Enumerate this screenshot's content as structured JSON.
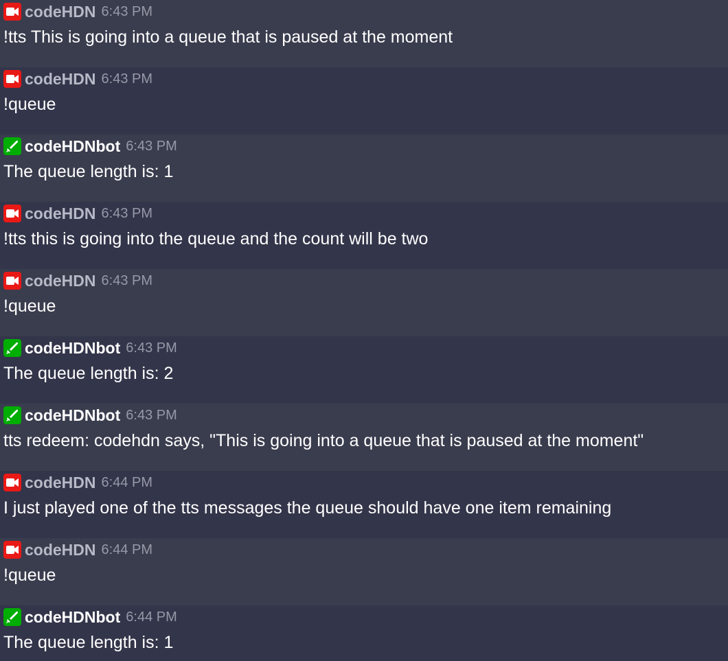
{
  "colors": {
    "broadcaster_badge": "#e91916",
    "moderator_badge": "#00ad03",
    "row_light": "#3a3d4e",
    "row_dark": "#33354a"
  },
  "messages": [
    {
      "user": "codeHDN",
      "time": "6:43 PM",
      "text": "!tts This is going into a queue that is paused at the moment",
      "badge": "video-camera-icon"
    },
    {
      "user": "codeHDN",
      "time": "6:43 PM",
      "text": "!queue",
      "badge": "video-camera-icon"
    },
    {
      "user": "codeHDNbot",
      "time": "6:43 PM",
      "text": "The queue length is: 1",
      "badge": "sword-icon"
    },
    {
      "user": "codeHDN",
      "time": "6:43 PM",
      "text": "!tts this is going into the queue and the count will be two",
      "badge": "video-camera-icon"
    },
    {
      "user": "codeHDN",
      "time": "6:43 PM",
      "text": "!queue",
      "badge": "video-camera-icon"
    },
    {
      "user": "codeHDNbot",
      "time": "6:43 PM",
      "text": "The queue length is: 2",
      "badge": "sword-icon"
    },
    {
      "user": "codeHDNbot",
      "time": "6:43 PM",
      "text": "tts redeem: codehdn says, \"This is going into a queue that is paused at the moment\"",
      "badge": "sword-icon"
    },
    {
      "user": "codeHDN",
      "time": "6:44 PM",
      "text": "I just played one of the tts messages the queue should have one item remaining",
      "badge": "video-camera-icon"
    },
    {
      "user": "codeHDN",
      "time": "6:44 PM",
      "text": "!queue",
      "badge": "video-camera-icon"
    },
    {
      "user": "codeHDNbot",
      "time": "6:44 PM",
      "text": "The queue length is: 1",
      "badge": "sword-icon"
    }
  ]
}
